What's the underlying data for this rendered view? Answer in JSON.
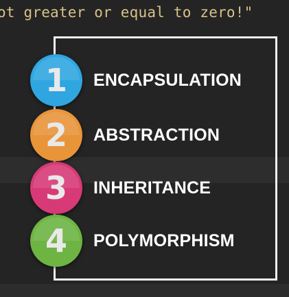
{
  "code": {
    "text": "ot greater or equal to zero!\""
  },
  "pillars": [
    {
      "number": "1",
      "label": "ENCAPSULATION",
      "color": "#2fa6e0"
    },
    {
      "number": "2",
      "label": "ABSTRACTION",
      "color": "#e8953a"
    },
    {
      "number": "3",
      "label": "INHERITANCE",
      "color": "#d73a76"
    },
    {
      "number": "4",
      "label": "POLYMORPHISM",
      "color": "#6db443"
    }
  ]
}
